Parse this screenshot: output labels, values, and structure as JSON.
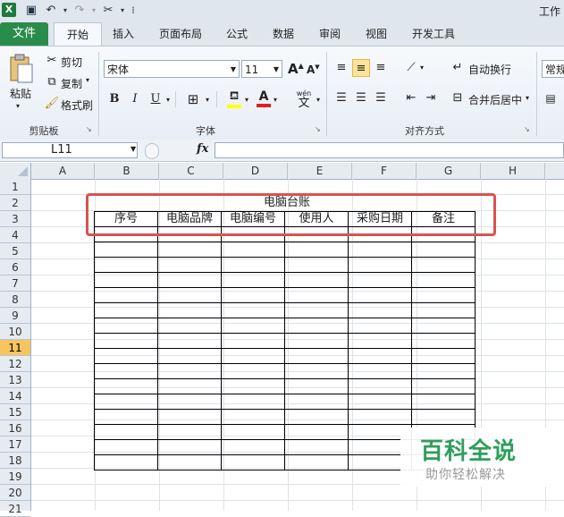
{
  "window": {
    "title": "工作"
  },
  "quick_access": {
    "logo": "X",
    "save_icon": "save-icon",
    "undo_icon": "undo-icon",
    "redo_icon": "redo-icon"
  },
  "ribbon_tabs": [
    "文件",
    "开始",
    "插入",
    "页面布局",
    "公式",
    "数据",
    "审阅",
    "视图",
    "开发工具"
  ],
  "ribbon": {
    "clipboard": {
      "label": "剪贴板",
      "paste": "粘贴",
      "cut": "剪切",
      "copy": "复制",
      "format_painter": "格式刷"
    },
    "font": {
      "label": "字体",
      "font_name": "宋体",
      "font_size": "11",
      "bold": "B",
      "italic": "I",
      "underline": "U",
      "grow": "A",
      "shrink": "A",
      "wen": "wén",
      "wen_char": "文"
    },
    "alignment": {
      "label": "对齐方式",
      "wrap_text": "自动换行",
      "merge_center": "合并后居中"
    },
    "number": {
      "format": "常规"
    }
  },
  "formula_bar": {
    "name_box": "L11",
    "fx": "fx"
  },
  "columns": [
    "A",
    "B",
    "C",
    "D",
    "E",
    "F",
    "G",
    "H"
  ],
  "rows": [
    "1",
    "2",
    "3",
    "4",
    "5",
    "6",
    "7",
    "8",
    "9",
    "10",
    "11",
    "12",
    "13",
    "14",
    "15",
    "16",
    "17",
    "18",
    "19",
    "20",
    "21"
  ],
  "selected_row": "11",
  "sheet": {
    "title": "电脑台账",
    "headers": [
      "序号",
      "电脑品牌",
      "电脑编号",
      "使用人",
      "采购日期",
      "备注"
    ]
  },
  "watermark": {
    "main": "百科全说",
    "sub": "助你轻松解决"
  },
  "colors": {
    "file_tab": "#2a8c4a",
    "selected_row_header": "#f7c55f",
    "highlight_box": "#d9534f",
    "watermark": "#2f9e5b"
  }
}
